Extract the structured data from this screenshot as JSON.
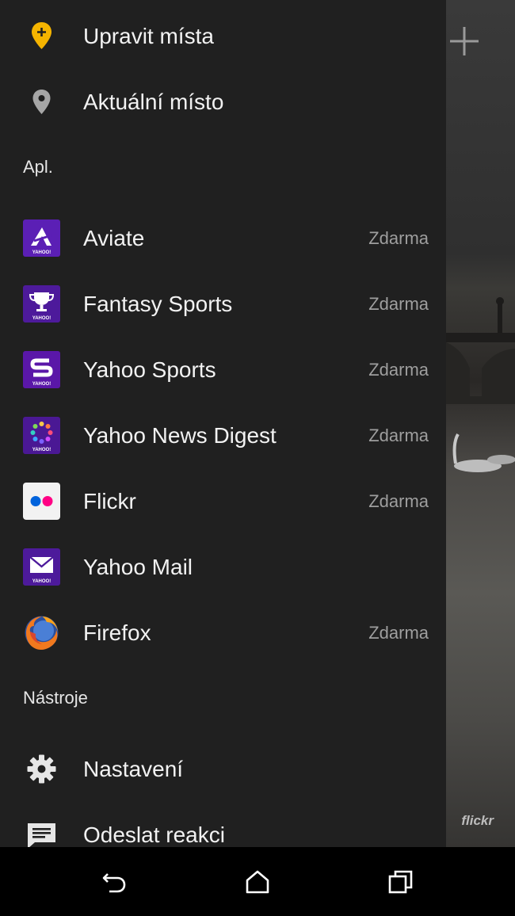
{
  "menu_top": [
    {
      "label": "Upravit místa",
      "icon": "location-plus-icon"
    },
    {
      "label": "Aktuální místo",
      "icon": "location-icon"
    }
  ],
  "sections": {
    "apps": "Apl.",
    "tools": "Nástroje"
  },
  "apps": [
    {
      "label": "Aviate",
      "price": "Zdarma",
      "icon": "aviate-app-icon"
    },
    {
      "label": "Fantasy Sports",
      "price": "Zdarma",
      "icon": "fantasy-sports-app-icon"
    },
    {
      "label": "Yahoo Sports",
      "price": "Zdarma",
      "icon": "yahoo-sports-app-icon"
    },
    {
      "label": "Yahoo News Digest",
      "price": "Zdarma",
      "icon": "yahoo-news-digest-app-icon"
    },
    {
      "label": "Flickr",
      "price": "Zdarma",
      "icon": "flickr-app-icon"
    },
    {
      "label": "Yahoo Mail",
      "price": "",
      "icon": "yahoo-mail-app-icon"
    },
    {
      "label": "Firefox",
      "price": "Zdarma",
      "icon": "firefox-app-icon"
    }
  ],
  "app_badge_text": "YAHOO!",
  "tools": [
    {
      "label": "Nastavení",
      "icon": "gear-icon"
    },
    {
      "label": "Odeslat reakci",
      "icon": "feedback-icon"
    }
  ],
  "background": {
    "watermark": "flickr"
  },
  "navbar": [
    "back-icon",
    "home-icon",
    "recents-icon"
  ]
}
